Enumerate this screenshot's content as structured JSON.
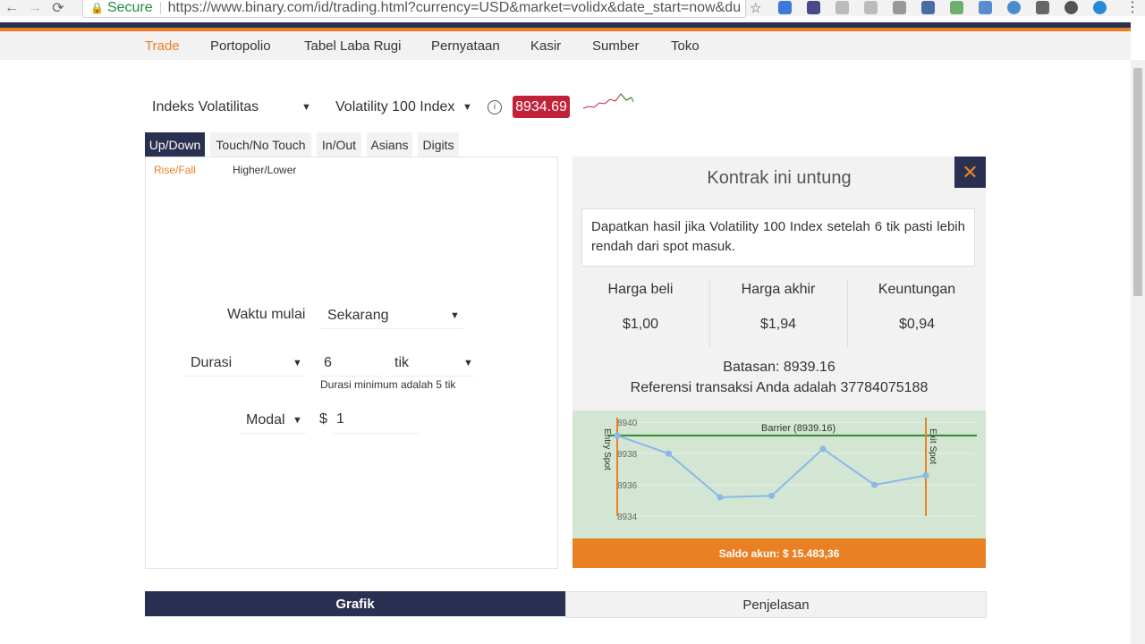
{
  "browser": {
    "secure_label": "Secure",
    "url": "https://www.binary.com/id/trading.html?currency=USD&market=volidx&date_start=now&duration_a"
  },
  "nav": {
    "items": [
      "Trade",
      "Portopolio",
      "Tabel Laba Rugi",
      "Pernyataan",
      "Kasir",
      "Sumber",
      "Toko"
    ],
    "active": "Trade"
  },
  "market": {
    "category": "Indeks Volatilitas",
    "underlying": "Volatility 100 Index",
    "spot_price": "8934.69"
  },
  "contract_tabs": [
    "Up/Down",
    "Touch/No Touch",
    "In/Out",
    "Asians",
    "Digits"
  ],
  "sub_tabs": [
    "Rise/Fall",
    "Higher/Lower"
  ],
  "form": {
    "start_label": "Waktu mulai",
    "start_value": "Sekarang",
    "duration_label": "Durasi",
    "duration_amount": "6",
    "duration_unit": "tik",
    "duration_hint": "Durasi minimum adalah 5 tik",
    "amount_type": "Modal",
    "currency_symbol": "$",
    "amount_value": "1"
  },
  "result": {
    "title": "Kontrak ini untung",
    "description": "Dapatkan hasil jika Volatility 100 Index setelah 6 tik pasti lebih rendah dari spot masuk.",
    "columns": [
      {
        "label": "Harga beli",
        "value": "$1,00"
      },
      {
        "label": "Harga akhir",
        "value": "$1,94"
      },
      {
        "label": "Keuntungan",
        "value": "$0,94"
      }
    ],
    "barrier": "Batasan: 8939.16",
    "reference": "Referensi transaksi Anda adalah 37784075188",
    "balance": "Saldo akun: $ 15.483,36"
  },
  "chart_data": {
    "type": "line",
    "y_ticks": [
      "8940",
      "8938",
      "8936",
      "8934"
    ],
    "ylim": [
      8934,
      8940.3
    ],
    "barrier_label": "Barrier (8939.16)",
    "barrier_value": 8939.16,
    "entry_label": "Entry Spot",
    "exit_label": "Exit Spot",
    "values": [
      8939.16,
      8938.0,
      8935.2,
      8935.3,
      8938.3,
      8936.0,
      8936.6
    ],
    "colors": {
      "line": "#8bb8e8",
      "barrier": "#2e8b2e",
      "marker": "#e98024"
    }
  },
  "bottom_tabs": {
    "chart": "Grafik",
    "explanation": "Penjelasan"
  }
}
